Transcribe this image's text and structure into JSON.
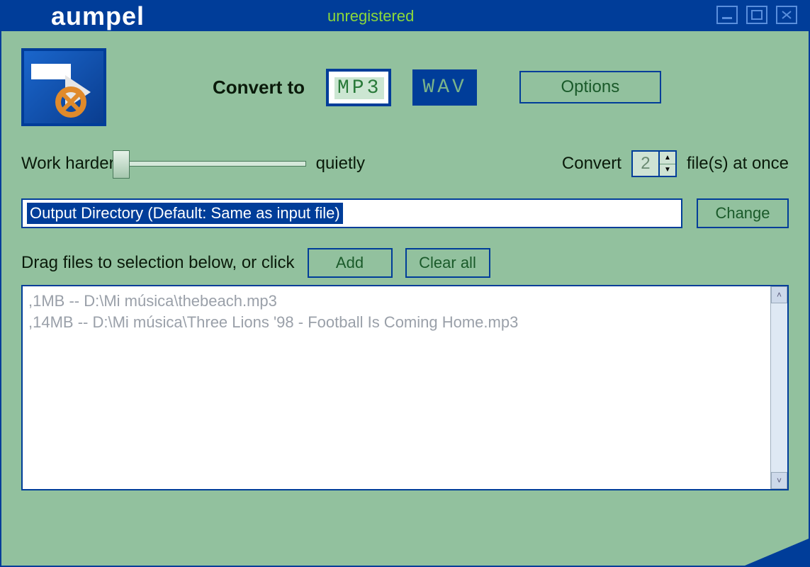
{
  "titlebar": {
    "app_name": "aumpel",
    "status": "unregistered"
  },
  "toolbar": {
    "convert_to_label": "Convert to",
    "format_mp3": "MP3",
    "format_wav": "WAV",
    "options_label": "Options"
  },
  "priority": {
    "left_label": "Work harder",
    "right_label": "quietly"
  },
  "concurrency": {
    "prefix": "Convert",
    "value": "2",
    "suffix": "file(s) at once"
  },
  "output": {
    "directory_text": "Output Directory (Default: Same as input file)",
    "change_label": "Change"
  },
  "filearea": {
    "instruction": "Drag files to selection below, or click",
    "add_label": "Add",
    "clear_label": "Clear all",
    "items": [
      ",1MB -- D:\\Mi música\\thebeach.mp3",
      ",14MB -- D:\\Mi música\\Three Lions '98 - Football Is Coming Home.mp3"
    ]
  }
}
